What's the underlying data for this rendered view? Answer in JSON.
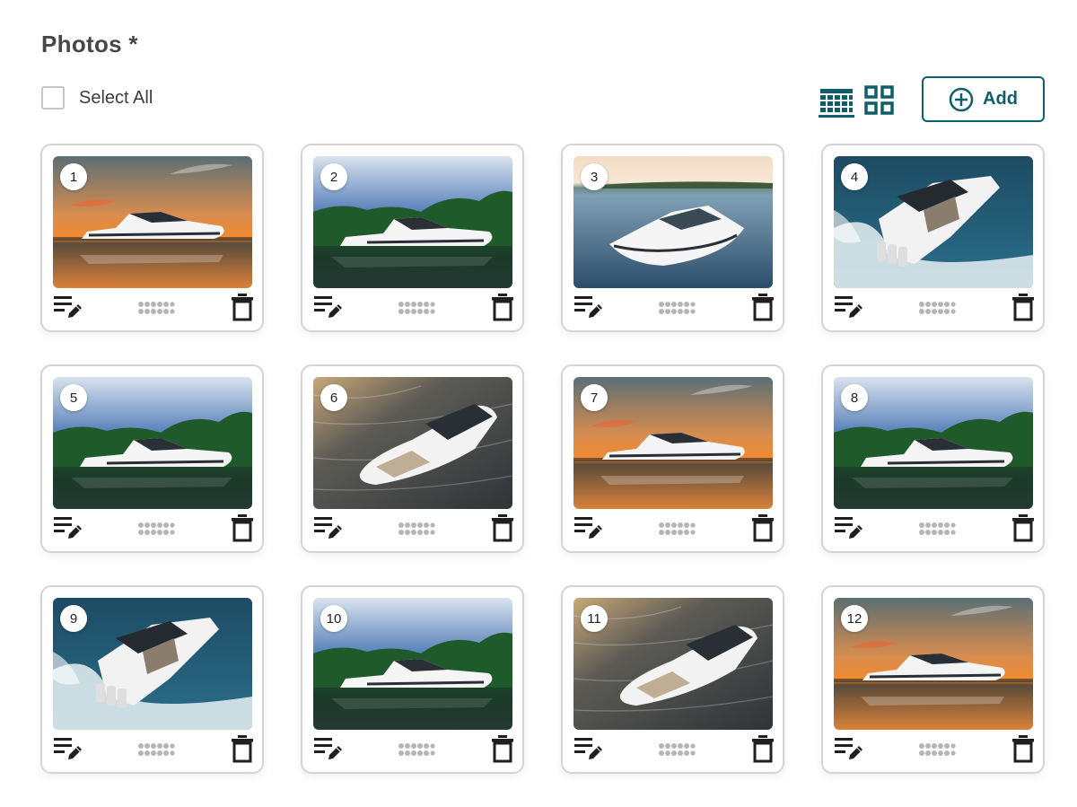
{
  "section": {
    "title": "Photos *"
  },
  "toolbar": {
    "select_all_label": "Select All",
    "select_all_checked": false,
    "view_modes": [
      "list-view-icon",
      "grid-view-icon"
    ],
    "active_view": "list-view-icon",
    "add_label": "Add",
    "add_icon": "plus-circle-icon"
  },
  "colors": {
    "accent": "#0f5e6b",
    "card_border": "#d4d4d4",
    "icon": "#1f1f1f",
    "handle": "#b5b5b5"
  },
  "photos": [
    {
      "number": "1",
      "scene": "sunset"
    },
    {
      "number": "2",
      "scene": "trees"
    },
    {
      "number": "3",
      "scene": "calm"
    },
    {
      "number": "4",
      "scene": "wake"
    },
    {
      "number": "5",
      "scene": "trees"
    },
    {
      "number": "6",
      "scene": "aerial"
    },
    {
      "number": "7",
      "scene": "sunset"
    },
    {
      "number": "8",
      "scene": "trees"
    },
    {
      "number": "9",
      "scene": "wake"
    },
    {
      "number": "10",
      "scene": "trees"
    },
    {
      "number": "11",
      "scene": "aerial"
    },
    {
      "number": "12",
      "scene": "sunset"
    }
  ],
  "card_actions": {
    "edit_icon": "edit-caption-icon",
    "drag_icon": "drag-handle-icon",
    "delete_icon": "trash-icon"
  }
}
